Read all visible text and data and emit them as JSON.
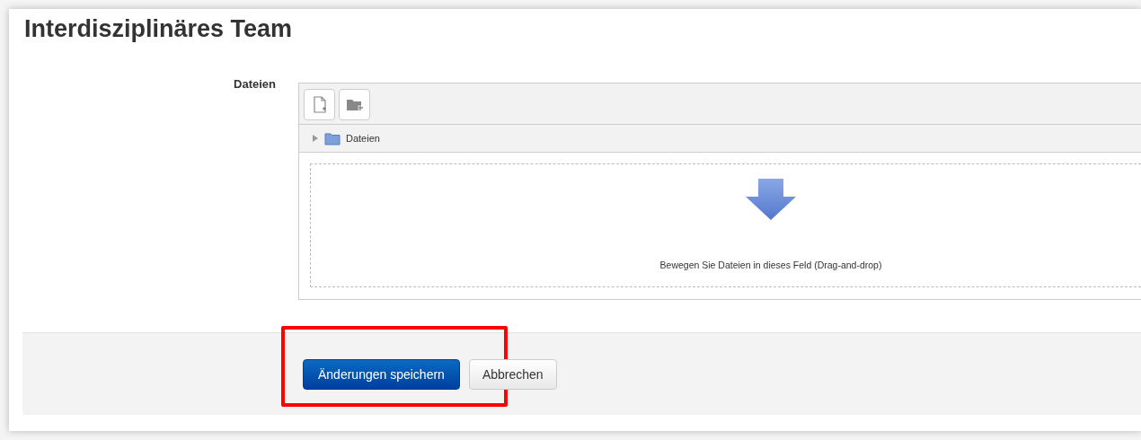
{
  "title": "Interdisziplinäres Team",
  "field": {
    "label": "Dateien",
    "path": "Dateien",
    "drop_hint": "Bewegen Sie Dateien in dieses Feld (Drag-and-drop)"
  },
  "buttons": [
    {
      "label": "Änderungen speichern",
      "kind": "primary",
      "highlighted": true
    },
    {
      "label": "Abbrechen",
      "kind": "secondary",
      "highlighted": false
    }
  ]
}
